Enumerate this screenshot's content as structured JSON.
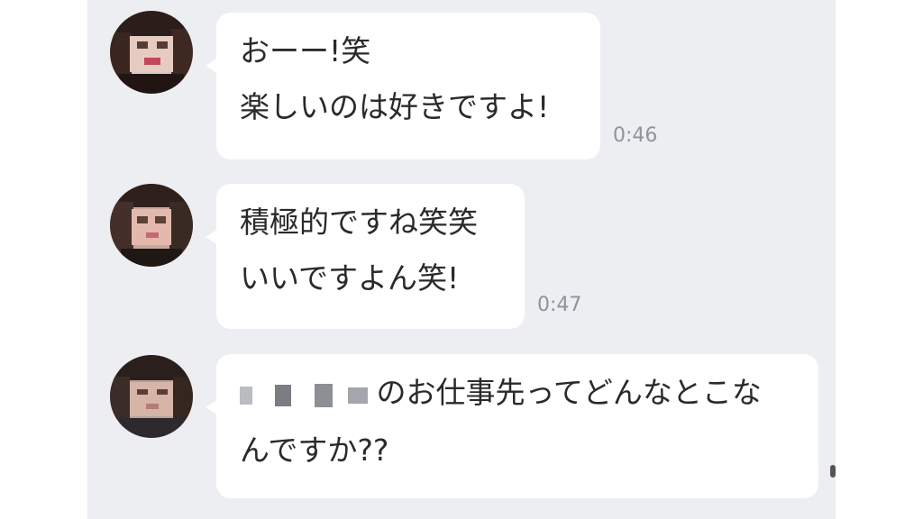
{
  "messages": [
    {
      "lines": [
        "おーー!笑",
        "楽しいのは好きですよ!"
      ],
      "time": "0:46"
    },
    {
      "lines": [
        "積極的ですね笑笑",
        "いいですよん笑!"
      ],
      "time": "0:47"
    },
    {
      "lines": [
        "のお仕事先ってどんなとこな",
        "んですか??"
      ]
    }
  ]
}
